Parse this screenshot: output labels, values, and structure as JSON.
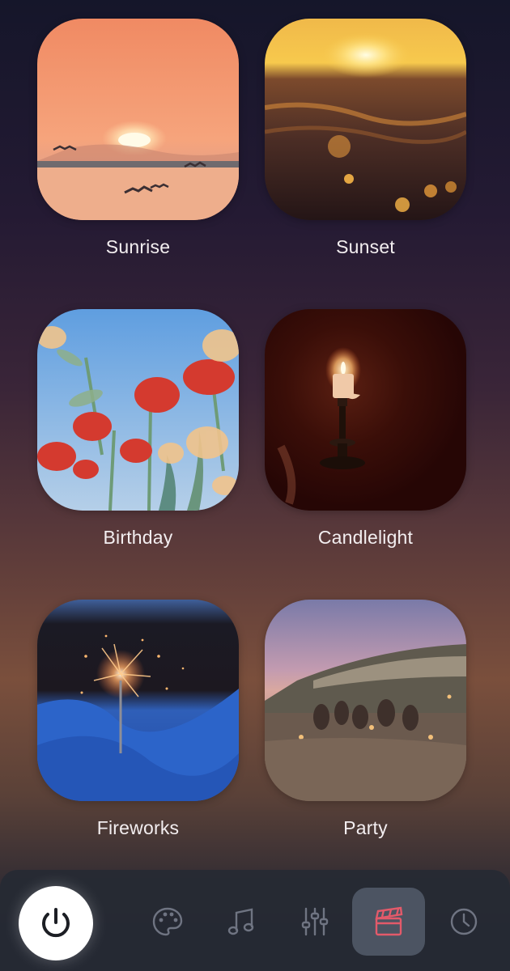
{
  "scenes": [
    {
      "label": "Sunrise",
      "icon": "sunrise-scene-thumbnail"
    },
    {
      "label": "Sunset",
      "icon": "sunset-scene-thumbnail"
    },
    {
      "label": "Birthday",
      "icon": "birthday-flowers-scene-thumbnail"
    },
    {
      "label": "Candlelight",
      "icon": "candlelight-scene-thumbnail"
    },
    {
      "label": "Fireworks",
      "icon": "sparkler-scene-thumbnail"
    },
    {
      "label": "Party",
      "icon": "beach-party-scene-thumbnail"
    }
  ],
  "nav": {
    "items": [
      {
        "icon": "power-icon",
        "active": false
      },
      {
        "icon": "palette-icon",
        "active": false
      },
      {
        "icon": "music-note-icon",
        "active": false
      },
      {
        "icon": "sliders-icon",
        "active": false
      },
      {
        "icon": "clapperboard-icon",
        "active": true
      },
      {
        "icon": "clock-icon",
        "active": false
      }
    ],
    "colors": {
      "bar": "#262a34",
      "active_bg": "#4c5462",
      "icon": "#6f7482",
      "active_icon": "#e35a6a"
    }
  }
}
